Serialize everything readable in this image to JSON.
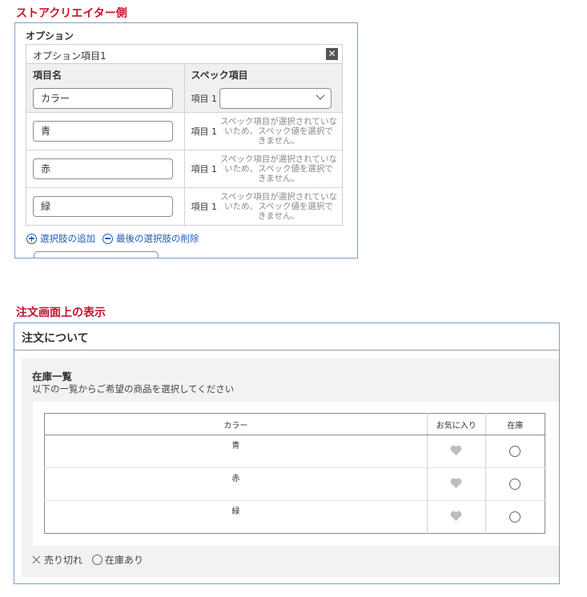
{
  "creator": {
    "heading": "ストアクリエイター側",
    "options_label": "オプション",
    "panel_title": "オプション項目1",
    "close_label": "✕",
    "col_name": "項目名",
    "col_spec": "スペック項目",
    "spec_label": "項目 1",
    "rows": [
      {
        "name": "カラー",
        "kind": "select",
        "select_value": ""
      },
      {
        "name": "青",
        "kind": "message",
        "message": "スペック項目が選択されていないため、スペック値を選択できません。"
      },
      {
        "name": "赤",
        "kind": "message",
        "message": "スペック項目が選択されていないため、スペック値を選択できません。"
      },
      {
        "name": "緑",
        "kind": "message",
        "message": "スペック項目が選択されていないため、スペック値を選択できません。"
      }
    ],
    "add_choice": "選択肢の追加",
    "remove_last_choice": "最後の選択肢の削除"
  },
  "order": {
    "heading": "注文画面上の表示",
    "title": "注文について",
    "stock_title": "在庫一覧",
    "stock_subtitle": "以下の一覧からご希望の商品を選択してください",
    "table": {
      "headers": [
        "カラー",
        "お気に入り",
        "在庫"
      ],
      "rows": [
        "青",
        "赤",
        "緑"
      ]
    },
    "legend": {
      "sold_out": "売り切れ",
      "in_stock": "在庫あり"
    }
  }
}
